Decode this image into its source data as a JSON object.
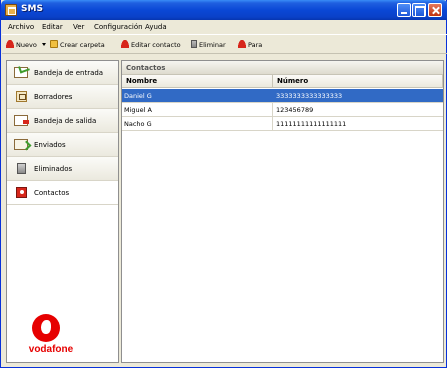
{
  "window": {
    "title": "SMS"
  },
  "menu": [
    {
      "label": "Archivo"
    },
    {
      "label": "Editar"
    },
    {
      "label": "Ver"
    },
    {
      "label": "Configuración"
    },
    {
      "label": "Ayuda"
    }
  ],
  "toolbar": {
    "new_label": "Nuevo",
    "create_folder_label": "Crear carpeta",
    "edit_contact_label": "Editar contacto",
    "delete_label": "Eliminar",
    "to_label": "Para"
  },
  "sidebar": {
    "items": [
      {
        "label": "Bandeja de entrada",
        "icon": "inbox-icon"
      },
      {
        "label": "Borradores",
        "icon": "drafts-icon"
      },
      {
        "label": "Bandeja de salida",
        "icon": "outbox-icon"
      },
      {
        "label": "Enviados",
        "icon": "sent-icon"
      },
      {
        "label": "Eliminados",
        "icon": "trash-icon"
      },
      {
        "label": "Contactos",
        "icon": "contacts-icon",
        "selected": true
      }
    ],
    "brand": "vodafone"
  },
  "panel": {
    "title": "Contactos",
    "columns": [
      "Nombre",
      "Número"
    ],
    "rows": [
      {
        "name": "Daniel G",
        "number": "3333333333333333",
        "selected": true
      },
      {
        "name": "Miguel A",
        "number": "123456789",
        "selected": false
      },
      {
        "name": "Nacho G",
        "number": "11111111111111111",
        "selected": false
      }
    ]
  },
  "colors": {
    "selection": "#316ac5",
    "brand_red": "#e60000",
    "titlebar_blue": "#0a48d6"
  }
}
